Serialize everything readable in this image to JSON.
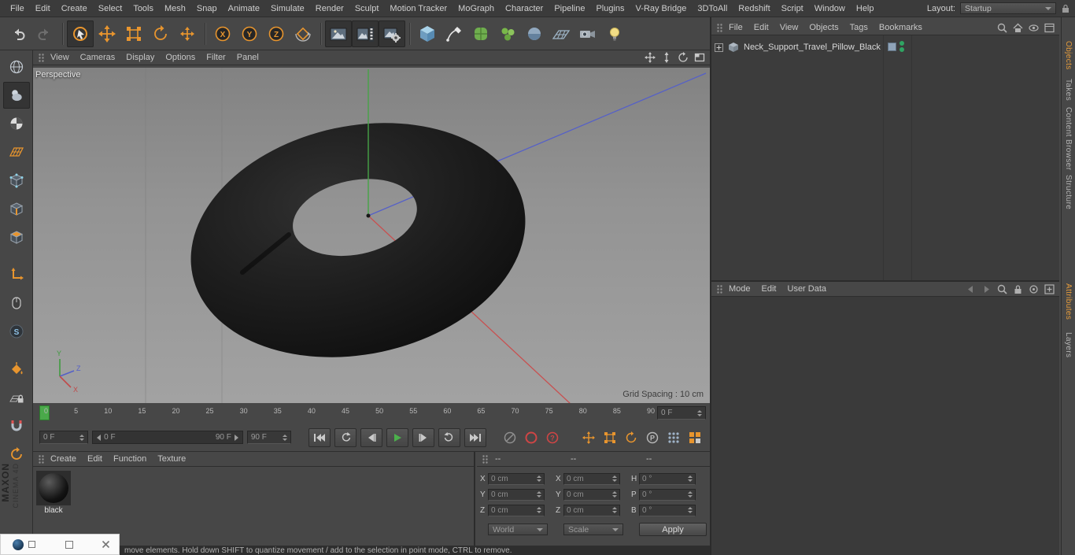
{
  "menubar": {
    "items": [
      "File",
      "Edit",
      "Create",
      "Select",
      "Tools",
      "Mesh",
      "Snap",
      "Animate",
      "Simulate",
      "Render",
      "Sculpt",
      "Motion Tracker",
      "MoGraph",
      "Character",
      "Pipeline",
      "Plugins",
      "V-Ray Bridge",
      "3DToAll",
      "Redshift",
      "Script",
      "Window",
      "Help"
    ],
    "layout_label": "Layout:",
    "layout_value": "Startup"
  },
  "toolbar": {
    "axis_locks": [
      "X",
      "Y",
      "Z"
    ]
  },
  "left_toolbar": {
    "solo_glyph": "S"
  },
  "viewport": {
    "menu": [
      "View",
      "Cameras",
      "Display",
      "Options",
      "Filter",
      "Panel"
    ],
    "view_label": "Perspective",
    "grid_spacing": "Grid Spacing : 10 cm",
    "axis_labels": {
      "x": "X",
      "y": "Y",
      "z": "Z"
    }
  },
  "timeline": {
    "ticks": [
      "0",
      "5",
      "10",
      "15",
      "20",
      "25",
      "30",
      "35",
      "40",
      "45",
      "50",
      "55",
      "60",
      "65",
      "70",
      "75",
      "80",
      "85",
      "90"
    ],
    "frame_spinner": "0 F"
  },
  "transport": {
    "start_frame": "0 F",
    "range_start": "0 F",
    "range_end": "90 F",
    "end_frame": "90 F",
    "help_glyph": "?",
    "parameter_glyph": "P"
  },
  "materials": {
    "menu": [
      "Create",
      "Edit",
      "Function",
      "Texture"
    ],
    "material_name": "black"
  },
  "coordinates": {
    "headers": [
      "--",
      "--",
      "--"
    ],
    "position": {
      "labels": [
        "X",
        "Y",
        "Z"
      ],
      "values": [
        "0 cm",
        "0 cm",
        "0 cm"
      ]
    },
    "size": {
      "labels": [
        "X",
        "Y",
        "Z"
      ],
      "values": [
        "0 cm",
        "0 cm",
        "0 cm"
      ]
    },
    "rotation": {
      "labels": [
        "H",
        "P",
        "B"
      ],
      "values": [
        "0 °",
        "0 °",
        "0 °"
      ]
    },
    "world_label": "World",
    "scale_label": "Scale",
    "apply_label": "Apply"
  },
  "objects_panel": {
    "menu": [
      "File",
      "Edit",
      "View",
      "Objects",
      "Tags",
      "Bookmarks"
    ],
    "object_name": "Neck_Support_Travel_Pillow_Black"
  },
  "attributes_panel": {
    "menu": [
      "Mode",
      "Edit",
      "User Data"
    ]
  },
  "side_tabs": {
    "top": [
      "Objects",
      "Takes",
      "Content Browser",
      "Structure"
    ],
    "bottom": [
      "Attributes",
      "Layers"
    ]
  },
  "statusbar": {
    "text": "move elements. Hold down SHIFT to quantize movement / add to the selection in point mode, CTRL to remove."
  },
  "branding": {
    "line1": "MAXON",
    "line2": "CINEMA 4D"
  }
}
